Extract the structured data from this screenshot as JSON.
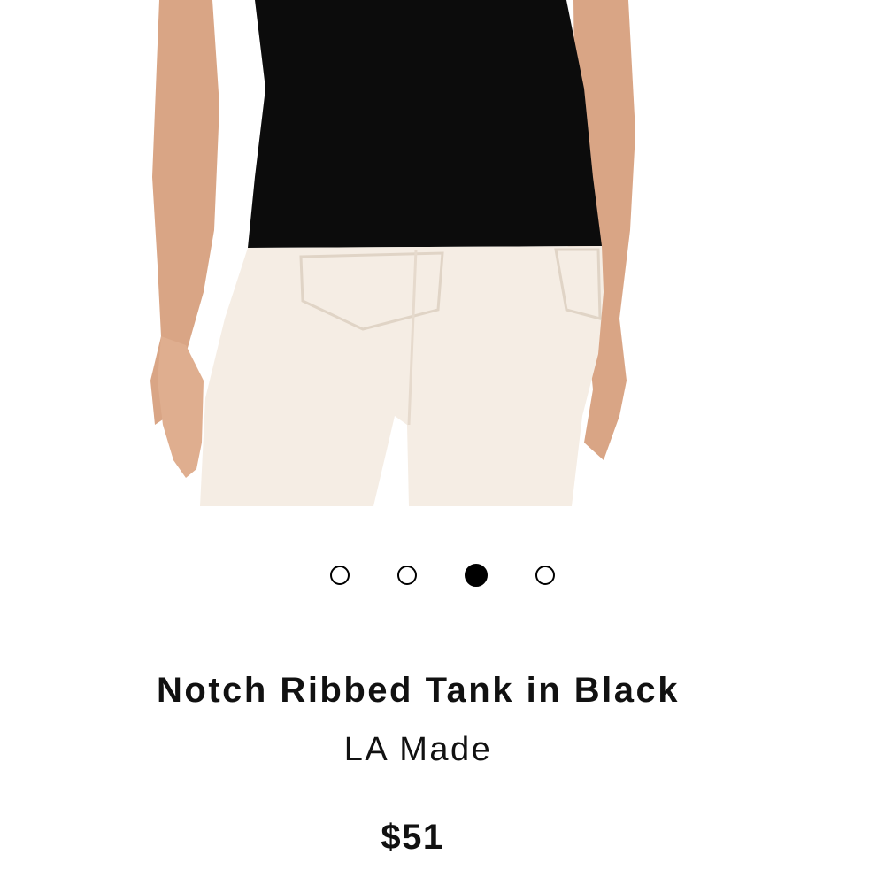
{
  "product": {
    "image_icon": "product-photo-back-view",
    "carousel": {
      "count": 4,
      "active_index": 2
    },
    "title": "Notch Ribbed Tank in Black",
    "brand": "LA Made",
    "price": "$51"
  },
  "colors": {
    "tank": "#0c0c0c",
    "pants": "#f5ede4",
    "skin": "#d9a585",
    "dot": "#000000"
  }
}
